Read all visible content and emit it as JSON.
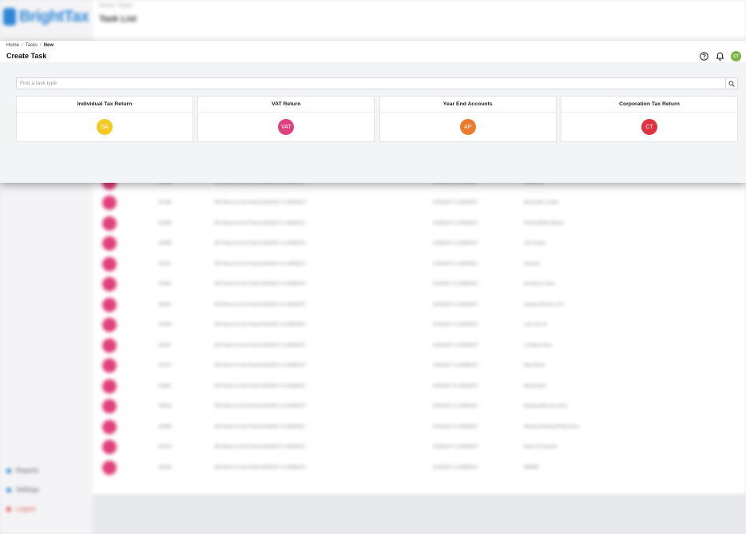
{
  "background": {
    "brand": "BrightTax",
    "breadcrumb": "Home / Tasks",
    "title": "Task List",
    "rows": [
      {
        "id": "100248",
        "desc": "VAT Return for the Period 01/06/2017 to 30/08/2017",
        "period": "01/06/2017 to 30/08/2017",
        "client": "AHB Items"
      },
      {
        "id": "101384",
        "desc": "VAT Return for the Period 01/06/2017 to 30/08/2017",
        "period": "01/06/2017 to 30/08/2017",
        "client": "Bird & Bate Limited"
      },
      {
        "id": "100408",
        "desc": "VAT Return for the Period 01/06/2017 to 30/08/2017",
        "period": "01/06/2017 to 30/08/2017",
        "client": "BTHhit-BGAR Widmar"
      },
      {
        "id": "100688",
        "desc": "VAT Return for the Period 01/06/2017 to 30/08/2017",
        "period": "01/06/2017 to 30/08/2017",
        "client": "CEI Scrapts"
      },
      {
        "id": "101267",
        "desc": "VAT Return for the Period 01/06/2017 to 30/08/2017",
        "period": "01/06/2017 to 30/08/2017",
        "client": "Dovetale"
      },
      {
        "id": "100405",
        "desc": "VAT Return for the Period 01/06/2017 to 30/08/2017",
        "period": "01/06/2017 to 30/08/2017",
        "client": "Everade for Stem"
      },
      {
        "id": "100461",
        "desc": "VAT Return for the Period 01/06/2017 to 30/08/2017",
        "period": "01/06/2017 to 30/08/2017",
        "client": "Jacksen Electrics LTD"
      },
      {
        "id": "100184",
        "desc": "VAT Return for the Period 01/06/2017 to 30/08/2017",
        "period": "01/06/2017 to 30/08/2017",
        "client": "Luke Test Cli"
      },
      {
        "id": "100447",
        "desc": "VAT Return for the Period 01/06/2017 to 30/08/2017",
        "period": "01/06/2017 to 30/08/2017",
        "client": "Lundbeck Items"
      },
      {
        "id": "100157",
        "desc": "VAT Return for the Period 01/06/2017 to 30/08/2017",
        "period": "01/06/2017 to 30/08/2017",
        "client": "Mark Morris"
      },
      {
        "id": "100851",
        "desc": "VAT Return for the Period 01/06/2017 to 30/08/2017",
        "period": "01/06/2017 to 30/08/2017",
        "client": "Merrik Items"
      },
      {
        "id": "100528",
        "desc": "VAT Return for the Period 01/06/2017 to 30/08/2017",
        "period": "01/06/2017 to 30/08/2017",
        "client": "Monday Afternoon Items"
      },
      {
        "id": "100948",
        "desc": "VAT Return for the Period 01/06/2017 to 30/08/2017",
        "period": "01/06/2017 to 30/08/2017",
        "client": "Monday Morning BTHhat Items"
      },
      {
        "id": "100716",
        "desc": "VAT Return for the Period 01/06/2017 to 30/08/2017",
        "period": "01/06/2017 to 30/08/2017",
        "client": "Name of Customer"
      },
      {
        "id": "100335",
        "desc": "VAT Return for the Period 01/06/2017 to 30/08/2017",
        "period": "01/06/2017 to 30/08/2017",
        "client": "RRR887"
      }
    ],
    "sidebar": {
      "reports": "Reports",
      "settings": "Settings",
      "logout": "Logout"
    }
  },
  "modal": {
    "breadcrumb": {
      "home": "Home",
      "tasks": "Tasks",
      "current": "New"
    },
    "title": "Create Task",
    "user_initials": "CT",
    "search": {
      "placeholder": "Find a task type",
      "value": ""
    },
    "task_types": [
      {
        "label": "Individual Tax Return",
        "abbr": "SA",
        "color": "#f2c925"
      },
      {
        "label": "VAT Return",
        "abbr": "VAT",
        "color": "#e0407c"
      },
      {
        "label": "Year End Accounts",
        "abbr": "AP",
        "color": "#ea7a2c"
      },
      {
        "label": "Corporation Tax Return",
        "abbr": "CT",
        "color": "#e0323f"
      }
    ]
  },
  "colors": {
    "accent": "#2f86d6",
    "avatar": "#7db545"
  }
}
